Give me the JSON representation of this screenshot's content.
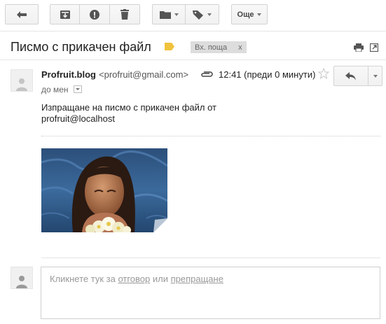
{
  "toolbar": {
    "back_icon": "arrow-left-icon",
    "archive_icon": "archive-icon",
    "spam_icon": "report-spam-icon",
    "delete_icon": "trash-icon",
    "move_icon": "folder-icon",
    "labels_icon": "label-tag-icon",
    "more_label": "Още"
  },
  "message": {
    "subject": "Писмо с прикачен файл",
    "important_color": "#f0c33c",
    "inbox_label": "Вх. поща",
    "inbox_remove": "x",
    "sender_name": "Profruit.blog",
    "sender_email": "<profruit@gmail.com>",
    "time": "12:41 (преди 0 минути)",
    "to": "до мен",
    "body_line1": "Изпращане на писмо с прикачен файл от",
    "body_line2": "profruit@localhost"
  },
  "reply": {
    "prefix": "Кликнете тук за ",
    "reply_link": "отговор",
    "middle": " или ",
    "forward_link": "препращане"
  }
}
